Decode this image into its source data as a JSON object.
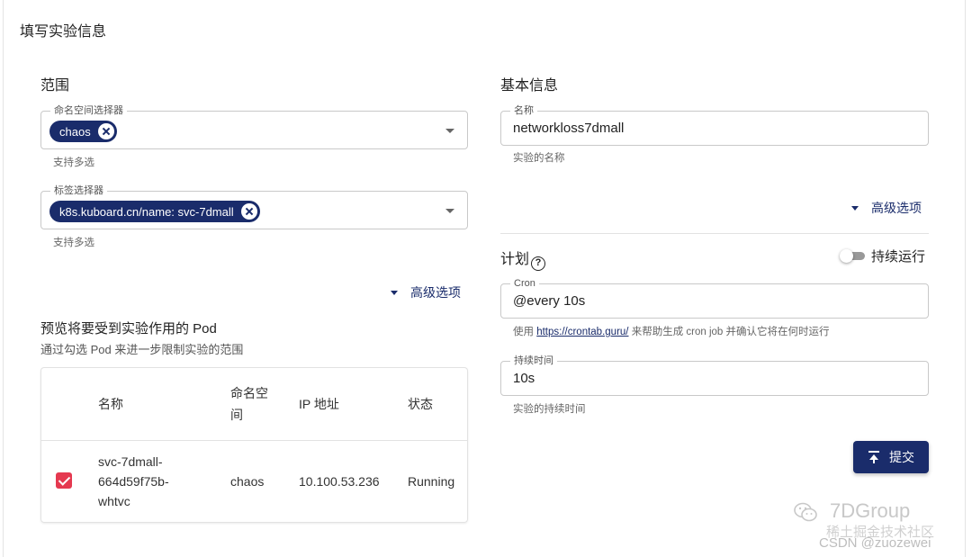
{
  "page_title": "填写实验信息",
  "scope": {
    "title": "范围",
    "namespace_selector": {
      "label": "命名空间选择器",
      "chip": "chaos",
      "helper": "支持多选"
    },
    "label_selector": {
      "label": "标签选择器",
      "chip": "k8s.kuboard.cn/name: svc-7dmall",
      "helper": "支持多选"
    },
    "advanced": "高级选项"
  },
  "preview": {
    "title": "预览将要受到实验作用的 Pod",
    "subtitle": "通过勾选 Pod 来进一步限制实验的范围",
    "columns": [
      "名称",
      "命名空\n间",
      "IP 地址",
      "状态"
    ],
    "rows": [
      {
        "checked": true,
        "name": "svc-7dmall-\n664d59f75b-\nwhtvc",
        "namespace": "chaos",
        "ip": "10.100.53.236",
        "status": "Running"
      }
    ]
  },
  "basic": {
    "title": "基本信息",
    "name_field": {
      "label": "名称",
      "value": "networkloss7dmall",
      "helper": "实验的名称"
    },
    "advanced": "高级选项"
  },
  "schedule": {
    "title": "计划",
    "toggle_label": "持续运行",
    "toggle_on": false,
    "cron_field": {
      "label": "Cron",
      "value": "@every 10s",
      "helper_prefix": "使用 ",
      "helper_link": "https://crontab.guru/",
      "helper_suffix": " 来帮助生成 cron job 并确认它将在何时运行"
    },
    "duration_field": {
      "label": "持续时间",
      "value": "10s",
      "helper": "实验的持续时间"
    }
  },
  "submit_label": "提交",
  "watermark": {
    "brand": "7DGroup",
    "line2": "稀土掘金技术社区",
    "line3": "CSDN @zuozewei"
  },
  "colors": {
    "primary": "#1a2c6b",
    "checkbox": "#e53950"
  }
}
